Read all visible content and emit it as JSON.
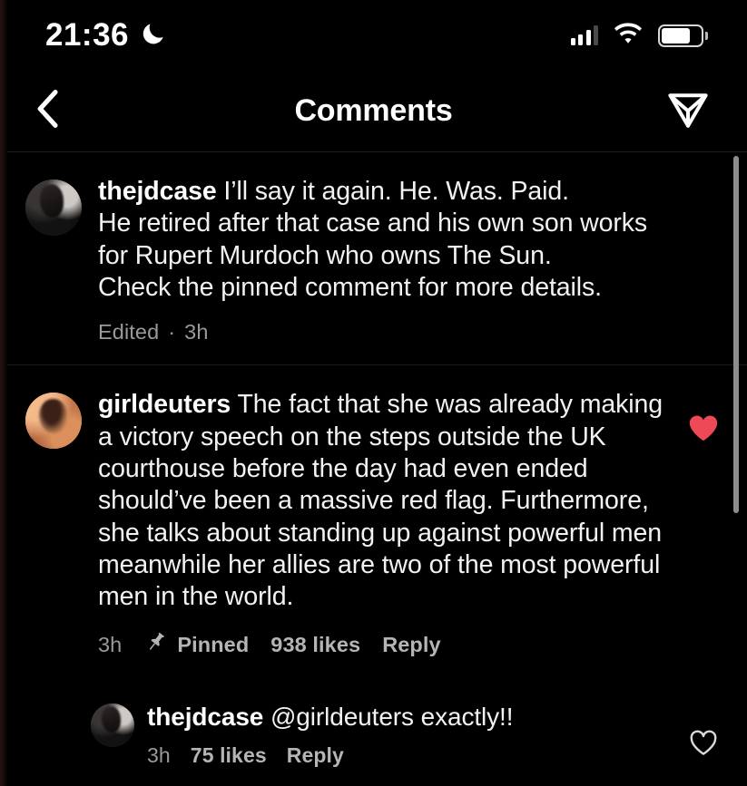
{
  "status_bar": {
    "time": "21:36",
    "moon_icon": "crescent-moon-icon",
    "signal_icon": "cellular-signal-icon",
    "signal_bars_active": 3,
    "signal_bars_total": 4,
    "wifi_icon": "wifi-icon",
    "battery_icon": "battery-icon",
    "battery_level_pct": 75
  },
  "header": {
    "back_icon": "chevron-left-icon",
    "title": "Comments",
    "share_icon": "send-paper-plane-icon"
  },
  "comments": [
    {
      "username": "thejdcase",
      "avatar": "grey-portrait-avatar",
      "text": "I’ll say it again. He. Was. Paid.\nHe retired after that case and his own son works for Rupert Murdoch who owns The Sun.\nCheck the pinned comment for more details.",
      "edited_label": "Edited",
      "separator": "·",
      "time": "3h",
      "pinned": false,
      "likes_label": "",
      "reply_label": "",
      "liked": null,
      "is_reply": false
    },
    {
      "username": "girldeuters",
      "avatar": "warm-portrait-avatar",
      "text": "The fact that she was already making a victory speech on the steps outside the UK courthouse before the day had even ended should’ve been a massive red flag. Furthermore, she talks about standing up against powerful men meanwhile her allies are two of the most powerful men in the world.",
      "edited_label": "",
      "separator": "",
      "time": "3h",
      "pinned": true,
      "pin_icon": "pushpin-icon",
      "pinned_label": "Pinned",
      "likes_label": "938 likes",
      "reply_label": "Reply",
      "liked": true,
      "is_reply": false
    },
    {
      "username": "thejdcase",
      "avatar": "grey-portrait-avatar",
      "text": "@girldeuters exactly!!",
      "edited_label": "",
      "separator": "",
      "time": "3h",
      "pinned": false,
      "likes_label": "75 likes",
      "reply_label": "Reply",
      "liked": false,
      "is_reply": true
    }
  ],
  "colors": {
    "background": "#000000",
    "text_primary": "#f2f2f2",
    "text_secondary": "#9a9a9a",
    "like_red": "#ed4956",
    "heart_outline": "#d9d9d9",
    "divider": "#1b1b1b",
    "scrollbar": "#8d8d8d"
  },
  "scrollbar": {
    "name": "comment-list-scrollbar",
    "position_pct": 0
  }
}
